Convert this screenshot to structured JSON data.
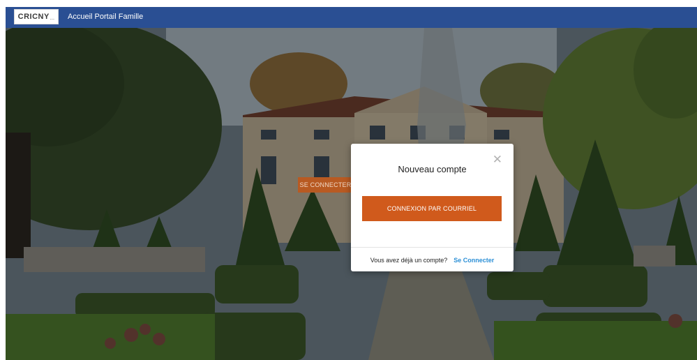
{
  "header": {
    "logo_text": "CRICNY",
    "logo_suffix": "...",
    "title": "Accueil Portail Famille",
    "background_color": "#2a4f93"
  },
  "background": {
    "description_icon": "park-chateau-photo",
    "behind_button_label": "SE CONNECTER"
  },
  "modal": {
    "title": "Nouveau compte",
    "close_icon": "close-icon",
    "primary_button_label": "CONNEXION PAR COURRIEL",
    "primary_button_color": "#d05a1c",
    "footer_text": "Vous avez déjà un compte?",
    "footer_link_label": "Se Connecter",
    "link_color": "#2b8fd6"
  }
}
